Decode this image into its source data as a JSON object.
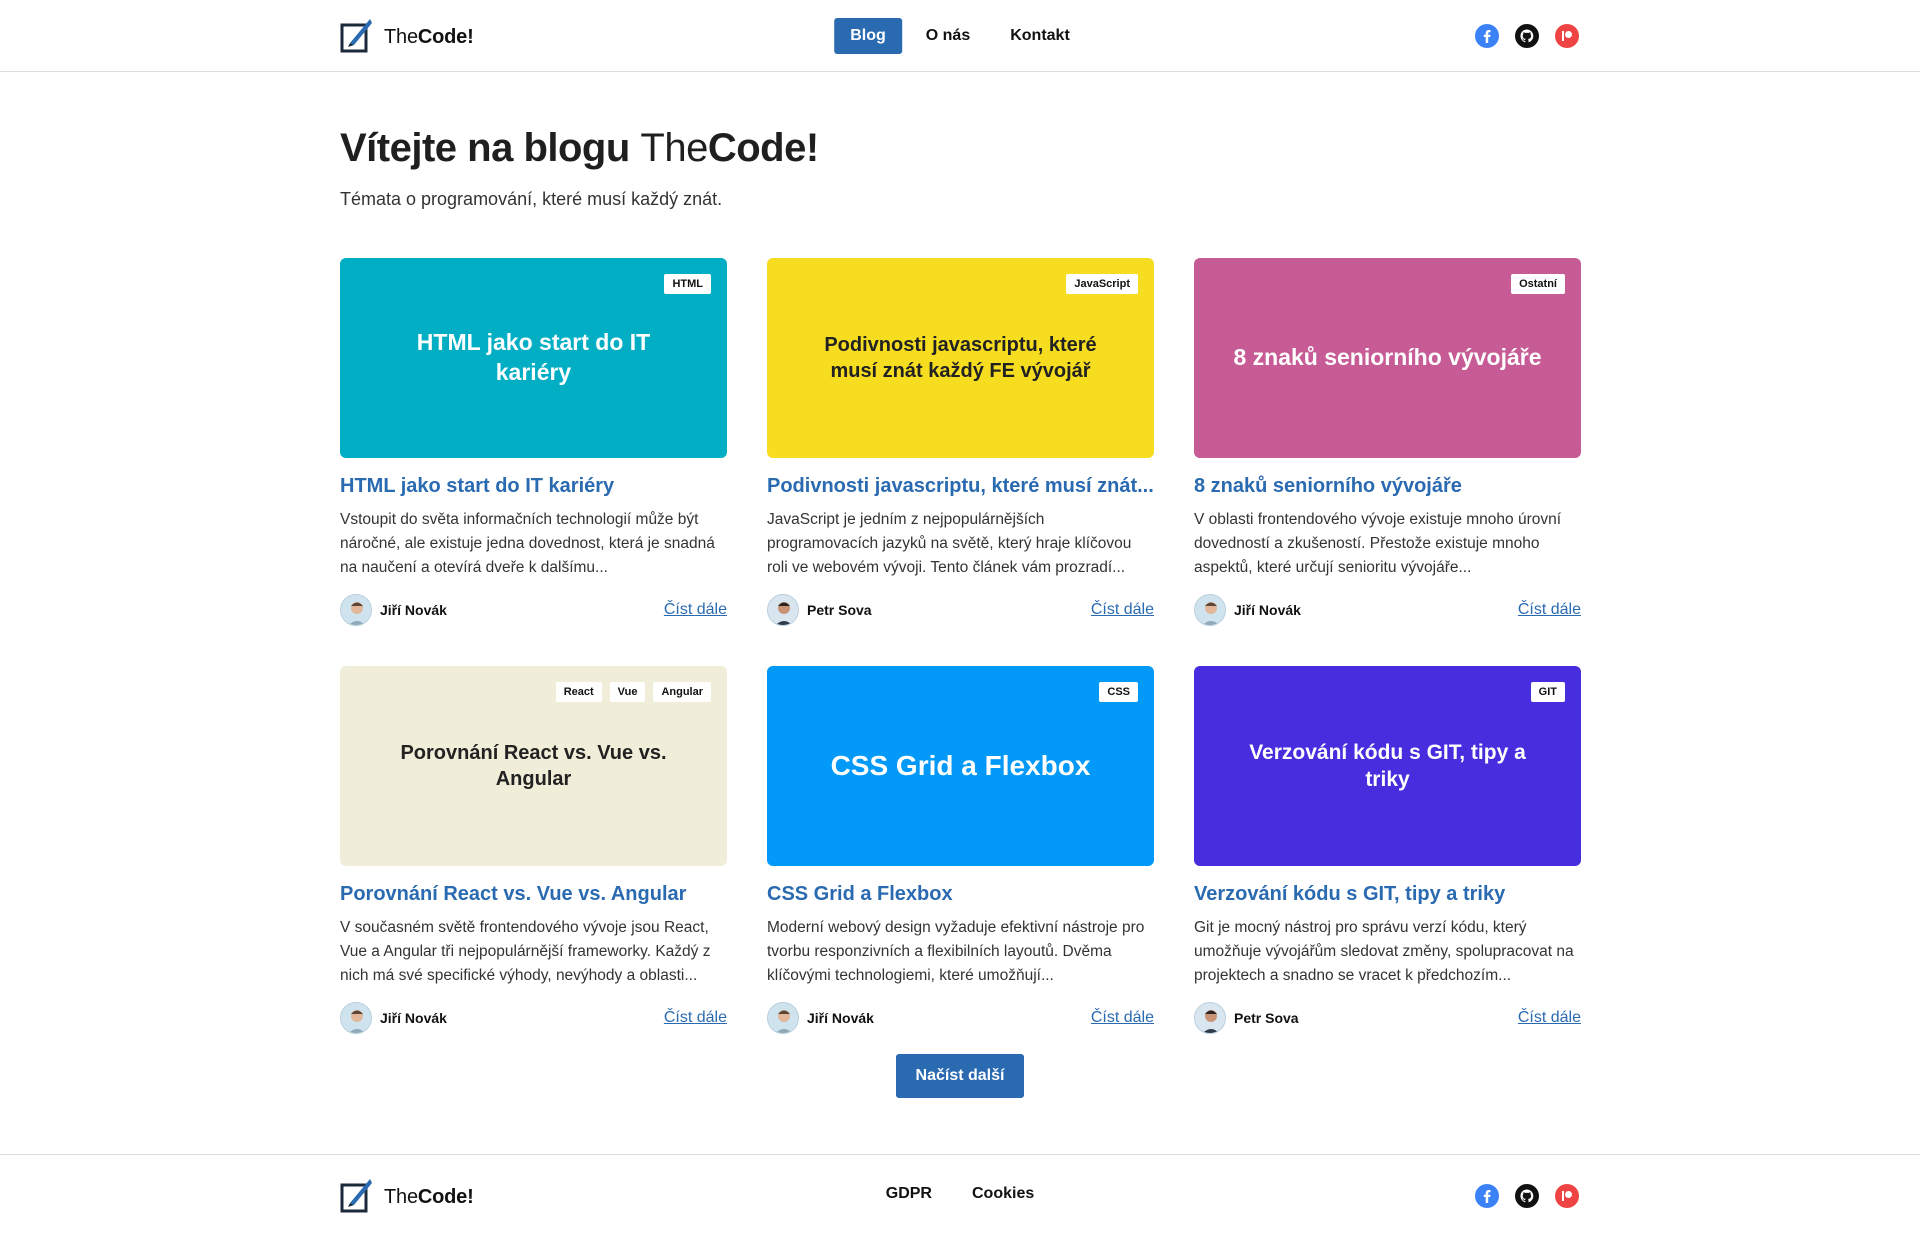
{
  "header": {
    "logo": {
      "text_light": "The",
      "text_bold": "Code!"
    },
    "nav": [
      {
        "label": "Blog",
        "active": true
      },
      {
        "label": "O nás",
        "active": false
      },
      {
        "label": "Kontakt",
        "active": false
      }
    ],
    "socials": [
      "facebook-icon",
      "github-icon",
      "patreon-icon"
    ]
  },
  "hero": {
    "title_bold": "Vítejte na blogu",
    "title_brand_light": "The",
    "title_brand_bold": "Code!",
    "subtitle": "Témata o programování, které musí každý znát."
  },
  "posts": [
    {
      "thumb_title": "HTML jako start do IT kariéry",
      "thumb_color": "#02aec4",
      "thumb_text_color": "#ffffff",
      "tags": [
        "HTML"
      ],
      "title": "HTML jako start do IT kariéry",
      "excerpt": "Vstoupit do světa informačních technologií může být náročné, ale existuje jedna dovednost, která je snadná na naučení a otevírá dveře k dalšímu...",
      "author": "Jiří Novák",
      "read_more": "Číst dále"
    },
    {
      "thumb_title": "Podivnosti javascriptu, které musí znát každý FE vývojář",
      "thumb_color": "#f6dd20",
      "thumb_text_color": "#222222",
      "tags": [
        "JavaScript"
      ],
      "title": "Podivnosti javascriptu, které musí znát...",
      "excerpt": "JavaScript je jedním z nejpopulárnějších programovacích jazyků na světě, který hraje klíčovou roli ve webovém vývoji. Tento článek vám prozradí...",
      "author": "Petr Sova",
      "read_more": "Číst dále"
    },
    {
      "thumb_title": "8 znaků seniorního vývojáře",
      "thumb_color": "#c75b95",
      "thumb_text_color": "#ffffff",
      "tags": [
        "Ostatní"
      ],
      "title": "8 znaků seniorního vývojáře",
      "excerpt": "V oblasti frontendového vývoje existuje mnoho úrovní dovedností a zkušeností. Přestože existuje mnoho aspektů, které určují senioritu vývojáře...",
      "author": "Jiří Novák",
      "read_more": "Číst dále"
    },
    {
      "thumb_title": "Porovnání React vs. Vue vs. Angular",
      "thumb_color": "#f0eed8",
      "thumb_text_color": "#222222",
      "tags": [
        "React",
        "Vue",
        "Angular"
      ],
      "title": "Porovnání React vs. Vue vs. Angular",
      "excerpt": "V současném světě frontendového vývoje jsou React, Vue a Angular tři nejpopulárnější frameworky. Každý z nich má své specifické výhody, nevýhody a oblasti...",
      "author": "Jiří Novák",
      "read_more": "Číst dále"
    },
    {
      "thumb_title": "CSS Grid a Flexbox",
      "thumb_color": "#0399f8",
      "thumb_text_color": "#ffffff",
      "tags": [
        "CSS"
      ],
      "title": "CSS Grid a Flexbox",
      "excerpt": "Moderní webový design vyžaduje efektivní nástroje pro tvorbu responzivních a flexibilních layoutů. Dvěma klíčovými technologiemi, které umožňují...",
      "author": "Jiří Novák",
      "read_more": "Číst dále"
    },
    {
      "thumb_title": "Verzování kódu s GIT, tipy a triky",
      "thumb_color": "#462ede",
      "thumb_text_color": "#ffffff",
      "tags": [
        "GIT"
      ],
      "title": "Verzování kódu s GIT, tipy a triky",
      "excerpt": "Git je mocný nástroj pro správu verzí kódu, který umožňuje vývojářům sledovat změny, spolupracovat na projektech a snadno se vracet k předchozím...",
      "author": "Petr Sova",
      "read_more": "Číst dále"
    }
  ],
  "load_more": "Načíst další",
  "footer": {
    "logo": {
      "text_light": "The",
      "text_bold": "Code!"
    },
    "links": [
      "GDPR",
      "Cookies"
    ]
  },
  "colors": {
    "accent": "#2a6ab1",
    "facebook": "#3b82f6",
    "patreon": "#ef4444"
  }
}
